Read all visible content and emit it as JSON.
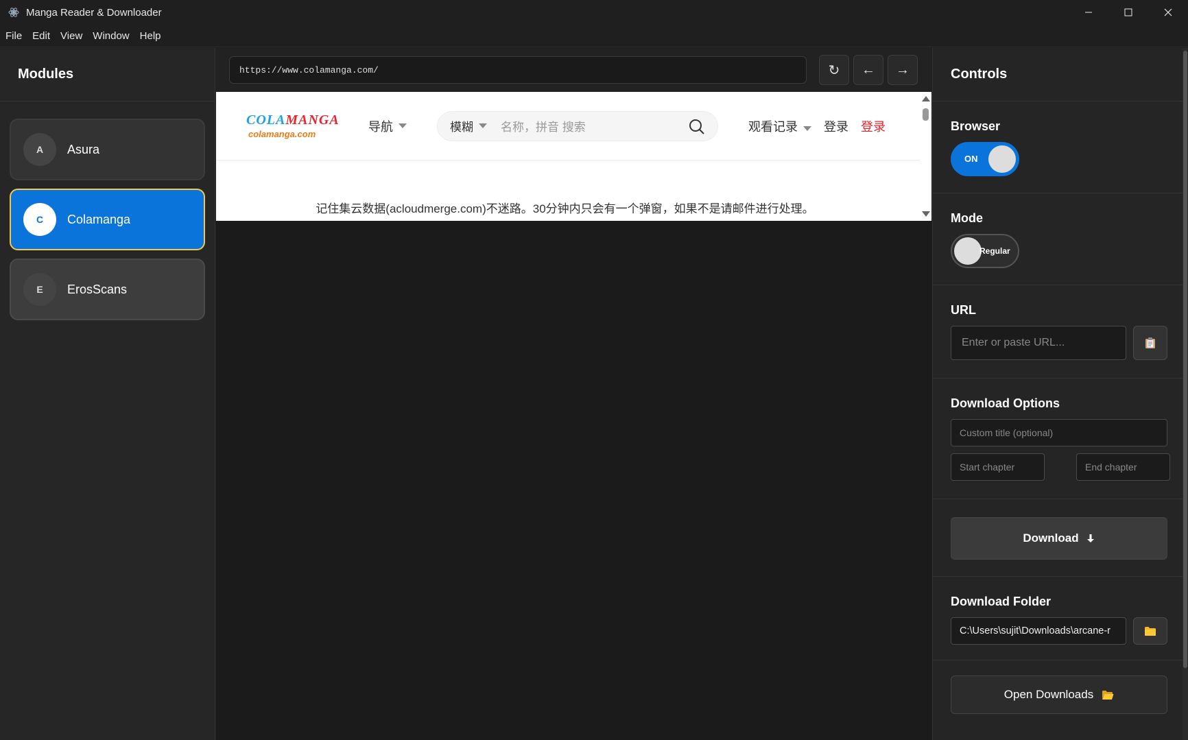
{
  "window": {
    "title": "Manga Reader & Downloader",
    "minimize": "—",
    "maximize": "☐",
    "close": "✕"
  },
  "menu": [
    "File",
    "Edit",
    "View",
    "Window",
    "Help"
  ],
  "sidebar": {
    "title": "Modules",
    "modules": [
      {
        "initial": "A",
        "name": "Asura"
      },
      {
        "initial": "C",
        "name": "Colamanga"
      },
      {
        "initial": "E",
        "name": "ErosScans"
      }
    ]
  },
  "browser": {
    "url": "https://www.colamanga.com/",
    "reload": "↻",
    "back": "←",
    "forward": "→",
    "site": {
      "logo_left": "COLA",
      "logo_right": "MANGA",
      "logo_domain": "colamanga.com",
      "nav": "导航",
      "search_type": "模糊",
      "search_placeholder": "名称，拼音 搜索",
      "history": "观看记录",
      "login": "登录",
      "register": "登录",
      "notice": "记住集云数据(acloudmerge.com)不迷路。30分钟内只会有一个弹窗，如果不是请邮件进行处理。"
    }
  },
  "controls": {
    "title": "Controls",
    "browser_label": "Browser",
    "browser_toggle": "ON",
    "mode_label": "Mode",
    "mode_toggle": "Regular",
    "url_label": "URL",
    "url_placeholder": "Enter or paste URL...",
    "download_options_label": "Download Options",
    "custom_title_placeholder": "Custom title (optional)",
    "start_chapter_placeholder": "Start chapter",
    "end_chapter_placeholder": "End chapter",
    "download_button": "Download",
    "download_folder_label": "Download Folder",
    "download_folder_value": "C:\\Users\\sujit\\Downloads\\arcane-r",
    "open_downloads_button": "Open Downloads"
  },
  "colors": {
    "accent": "#0a74da",
    "active_border": "#f2c94c",
    "logo_blue": "#1aa3e8",
    "logo_red": "#e8252b",
    "logo_orange": "#f07a14",
    "folder_yellow": "#f5b921"
  }
}
